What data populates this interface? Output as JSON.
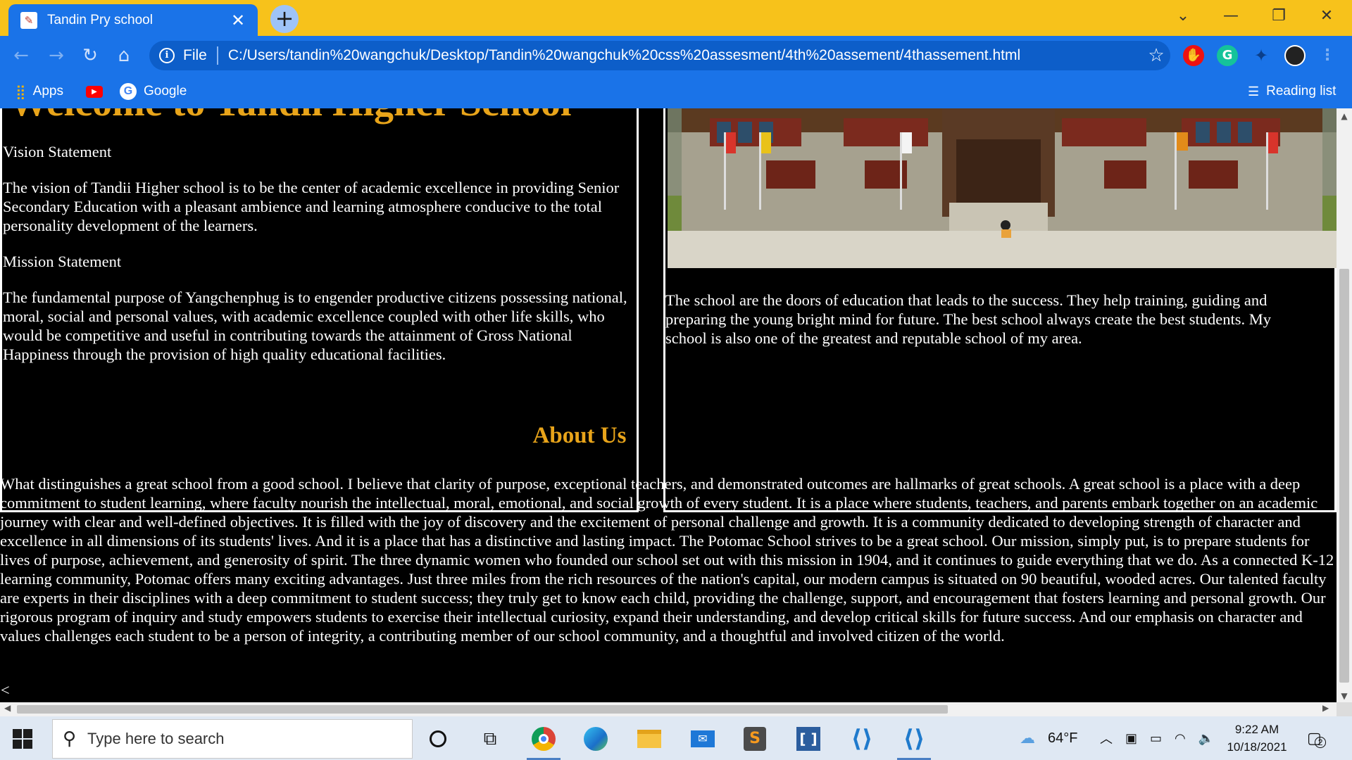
{
  "browser": {
    "tab_title": "Tandin Pry school",
    "scheme_label": "File",
    "url": "C:/Users/tandin%20wangchuk/Desktop/Tandin%20wangchuk%20css%20assesment/4th%20assement/4thassement.html",
    "bookmarks": {
      "apps": "Apps",
      "google": "Google",
      "reading_list": "Reading list"
    }
  },
  "page": {
    "title": "Welcome to Tandii Higher School",
    "vision_heading": "Vision Statement",
    "vision_text": "The vision of Tandii Higher school is to be the center of academic excellence in providing Senior Secondary Education with a pleasant ambience and learning atmosphere conducive to the total personality development of the learners.",
    "mission_heading": "Mission Statement",
    "mission_text": "The fundamental purpose of Yangchenphug is to engender productive citizens possessing national, moral, social and personal values, with academic excellence coupled with other life skills, who would be competitive and useful in contributing towards the attainment of Gross National Happiness through the provision of high quality educational facilities.",
    "school_text": "The school are the doors of education that leads to the success. They help training, guiding and preparing the young bright mind for future. The best school always create the best students. My school is also one of the greatest and reputable school of my area.",
    "about_title": "About Us",
    "about_text": "What distinguishes a great school from a good school. I believe that clarity of purpose, exceptional teachers, and demonstrated outcomes are hallmarks of great schools. A great school is a place with a deep commitment to student learning, where faculty nourish the intellectual, moral, emotional, and social growth of every student. It is a place where students, teachers, and parents embark together on an academic journey with clear and well-defined objectives. It is filled with the joy of discovery and the excitement of personal challenge and growth. It is a community dedicated to developing strength of character and excellence in all dimensions of its students' lives. And it is a place that has a distinctive and lasting impact. The Potomac School strives to be a great school. Our mission, simply put, is to prepare students for lives of purpose, achievement, and generosity of spirit. The three dynamic women who founded our school set out with this mission in 1904, and it continues to guide everything that we do. As a connected K-12 learning community, Potomac offers many exciting advantages. Just three miles from the rich resources of the nation's capital, our modern campus is situated on 90 beautiful, wooded acres. Our talented faculty are experts in their disciplines with a deep commitment to student success; they truly get to know each child, providing the challenge, support, and encouragement that fosters learning and personal growth. Our rigorous program of inquiry and study empowers students to exercise their intellectual curiosity, expand their understanding, and develop critical skills for future success. And our emphasis on character and values challenges each student to be a person of integrity, a contributing member of our school community, and a thoughtful and involved citizen of the world.",
    "stray_char": "<"
  },
  "taskbar": {
    "search_placeholder": "Type here to search",
    "weather": "64°F",
    "time": "9:22 AM",
    "date": "10/18/2021",
    "notification_count": "2"
  },
  "colors": {
    "tabbar": "#f7c21b",
    "chrome_blue": "#1a73e8",
    "heading_gold": "#e8a41a",
    "page_background": "#000000"
  },
  "icons": [
    "school-favicon",
    "close-icon",
    "plus-icon",
    "chevron-down-icon",
    "minimize-icon",
    "restore-icon",
    "back-icon",
    "forward-icon",
    "reload-icon",
    "home-icon",
    "info-icon",
    "star-icon",
    "apps-grid-icon",
    "youtube-icon",
    "google-icon",
    "reading-list-icon",
    "windows-start-icon",
    "search-icon",
    "cortana-icon",
    "task-view-icon",
    "chrome-icon",
    "edge-icon",
    "file-explorer-icon",
    "mail-icon",
    "sublime-icon",
    "brackets-icon",
    "vscode-icon",
    "weather-icon",
    "notification-icon"
  ]
}
